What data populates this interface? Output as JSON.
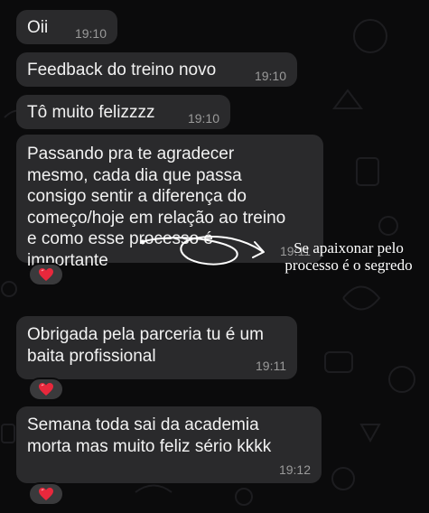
{
  "messages": [
    {
      "text": "Oii",
      "time": "19:10"
    },
    {
      "text": "Feedback do treino novo",
      "time": "19:10"
    },
    {
      "text": "Tô muito felizzzz",
      "time": "19:10"
    },
    {
      "lines": [
        "Passando pra te agradecer",
        "mesmo, cada dia que passa",
        "consigo sentir a diferença do",
        "começo/hoje em relação ao treino",
        "e como esse processo é",
        "importante"
      ],
      "time": "19:11",
      "reaction": "heart-emoji"
    },
    {
      "lines": [
        "Obrigada pela parceria tu é um",
        "baita profissional"
      ],
      "time": "19:11",
      "reaction": "heart-emoji"
    },
    {
      "lines": [
        "Semana toda sai da academia",
        "morta mas muito feliz sério kkkk"
      ],
      "time": "19:12",
      "reaction": "heart-emoji"
    }
  ],
  "annotation": {
    "line1": "Se apaixonar pelo",
    "line2": "processo é o segredo"
  },
  "colors": {
    "background": "#0b0b0c",
    "bubble": "#2a2a2c",
    "text": "#f2f2f2",
    "timestamp": "#9a9a9a",
    "heart": "#e8283c"
  }
}
